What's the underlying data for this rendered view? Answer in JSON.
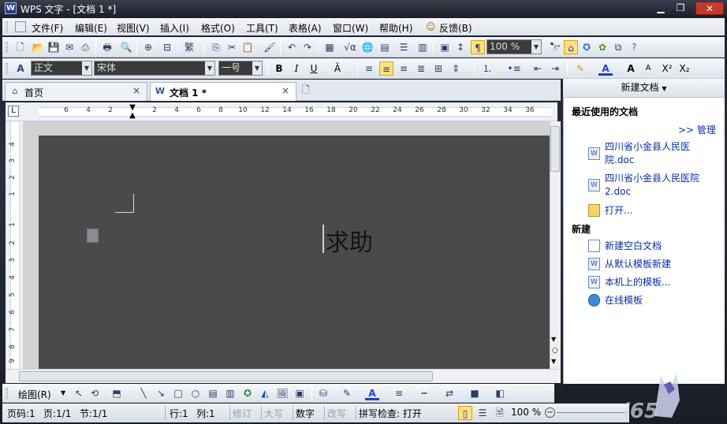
{
  "window": {
    "title": "WPS 文字 - [文档 1 *]",
    "app_icon": "W"
  },
  "menu": [
    "文件(F)",
    "编辑(E)",
    "视图(V)",
    "插入(I)",
    "格式(O)",
    "工具(T)",
    "表格(A)",
    "窗口(W)",
    "帮助(H)",
    "反馈(B)"
  ],
  "toolbar": {
    "zoom": "100 %"
  },
  "format_bar": {
    "style": "正文",
    "font": "宋体",
    "size": "一号",
    "bold": "B",
    "italic": "I",
    "underline": "U",
    "font_size_grow": "A",
    "font_size_shrink": "A",
    "superscript": "X²",
    "subscript": "X₂"
  },
  "tabs": [
    {
      "label": "首页",
      "close": "×"
    },
    {
      "label": "文档 1 *",
      "close": "×"
    }
  ],
  "ruler": {
    "h_numbers": [
      "6",
      "4",
      "2",
      "2",
      "4",
      "6",
      "8",
      "10",
      "12",
      "14",
      "16",
      "18",
      "20",
      "22",
      "24",
      "26",
      "28",
      "30",
      "32",
      "34",
      "36"
    ],
    "v_numbers": [
      "4",
      "3",
      "2",
      "1",
      "1",
      "2",
      "3",
      "4",
      "5",
      "6",
      "7",
      "8",
      "9"
    ]
  },
  "document": {
    "text": "求助"
  },
  "task_pane": {
    "title": "新建文档",
    "recent_heading": "最近使用的文档",
    "manage": ">> 管理",
    "recent": [
      "四川省小金县人民医院.doc",
      "四川省小金县人民医院2.doc"
    ],
    "open": "打开...",
    "new_heading": "新建",
    "new_items": [
      "新建空白文档",
      "从默认模板新建",
      "本机上的模板...",
      "在线模板"
    ]
  },
  "draw_bar": {
    "label": "绘图(R)"
  },
  "status": {
    "page": "页码:1",
    "pages": "页:1/1",
    "section": "节:1/1",
    "row": "行:1",
    "col": "列:1",
    "revise": "修订",
    "caps": "大写",
    "num": "数字",
    "overwrite": "改写",
    "spell": "拼写检查: 打开",
    "zoom": "100 %"
  },
  "colors": {
    "doc_bg": "#4a4a4a",
    "link": "#0a2db0",
    "accent": "#2a56a8"
  }
}
